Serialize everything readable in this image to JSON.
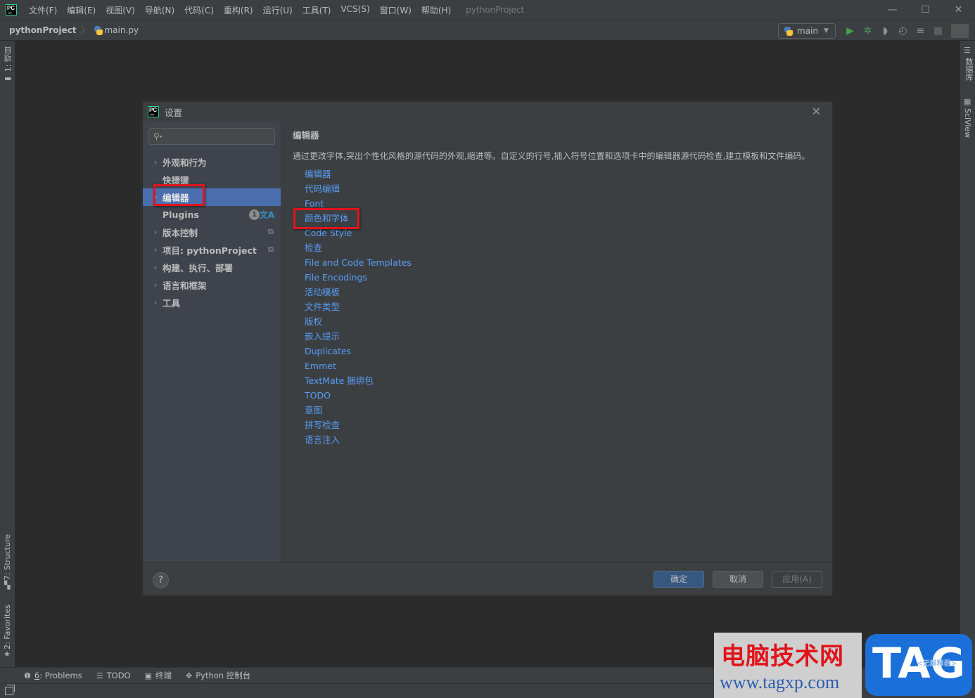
{
  "app": {
    "menu": [
      "文件(F)",
      "编辑(E)",
      "视图(V)",
      "导航(N)",
      "代码(C)",
      "重构(R)",
      "运行(U)",
      "工具(T)",
      "VCS(S)",
      "窗口(W)",
      "帮助(H)"
    ],
    "project_title": "pythonProject",
    "window_controls": {
      "minimize": "—",
      "maximize": "☐",
      "close": "✕"
    }
  },
  "navbar": {
    "project": "pythonProject",
    "separator": "〉",
    "file": "main.py",
    "run_config": "main",
    "toolbar_icons": [
      "run-icon",
      "debug-icon",
      "coverage-icon",
      "profile-icon",
      "concurrency-icon",
      "stop-icon",
      "search-icon"
    ]
  },
  "left_strip": {
    "project_tab": "1: 项目",
    "structure_tab": "7: Structure",
    "favorites_tab": "2: Favorites"
  },
  "right_strip": {
    "database_tab": "数据库",
    "sciview_tab": "SciView"
  },
  "dialog": {
    "title": "设置",
    "search_placeholder": "",
    "tree": [
      {
        "label": "外观和行为",
        "expandable": true
      },
      {
        "label": "快捷键",
        "expandable": false
      },
      {
        "label": "编辑器",
        "expandable": true,
        "selected": true
      },
      {
        "label": "Plugins",
        "expandable": false,
        "badge": "1"
      },
      {
        "label": "版本控制",
        "expandable": true
      },
      {
        "label": "项目: pythonProject",
        "expandable": true
      },
      {
        "label": "构建、执行、部署",
        "expandable": true
      },
      {
        "label": "语言和框架",
        "expandable": true
      },
      {
        "label": "工具",
        "expandable": true
      }
    ],
    "section_title": "编辑器",
    "description": "通过更改字体,突出个性化风格的源代码的外观,缩进等。自定义的行号,插入符号位置和选项卡中的编辑器源代码检查,建立模板和文件编码。",
    "links": [
      "编辑器",
      "代码编辑",
      "Font",
      "颜色和字体",
      "Code Style",
      "检查",
      "File and Code Templates",
      "File Encodings",
      "活动模板",
      "文件类型",
      "版权",
      "嵌入提示",
      "Duplicates",
      "Emmet",
      "TextMate 捆绑包",
      "TODO",
      "意图",
      "拼写检查",
      "语言注入"
    ],
    "highlighted_link": "颜色和字体",
    "buttons": {
      "help": "?",
      "ok": "确定",
      "cancel": "取消",
      "apply": "应用(A)"
    }
  },
  "bottom_tabs": [
    {
      "num": "6",
      "label": ": Problems"
    },
    {
      "label": "TODO"
    },
    {
      "label": "终端"
    },
    {
      "label": "Python 控制台"
    }
  ],
  "watermark": {
    "cn": "电脑技术网",
    "url": "www.tagxp.com",
    "tag": "TAG",
    "sub": "<无解释器>"
  },
  "colors": {
    "accent_selection": "#4b6eaf",
    "link": "#589df6",
    "highlight_box": "#e0141b",
    "ok_button": "#365880"
  }
}
